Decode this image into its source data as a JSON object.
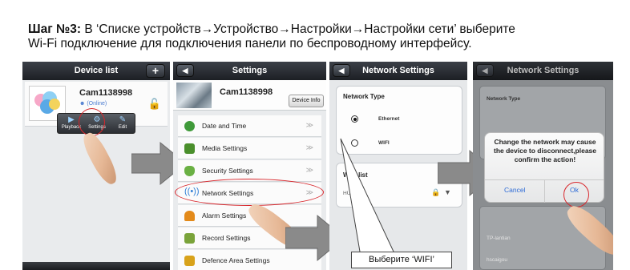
{
  "instruction": {
    "step": "Шаг №3:",
    "line1": "В ‘Списке устройств→Устройство→Настройки→Настройки сети’ выберите",
    "line2": "Wi-Fi подключение для подключения панели по беспроводному интерфейсу."
  },
  "device_list": {
    "title": "Device list",
    "add_label": "+",
    "device_name": "Cam1138998",
    "device_status": "(Online)",
    "actions": [
      {
        "label": "Playback",
        "icon": "play-icon"
      },
      {
        "label": "Settings",
        "icon": "gear-icon"
      },
      {
        "label": "Edit",
        "icon": "edit-icon"
      }
    ]
  },
  "settings": {
    "title": "Settings",
    "device_name": "Cam1138998",
    "device_info_label": "Device Info",
    "items": [
      {
        "label": "Date and Time",
        "icon": "clock-icon",
        "color": "#3f9a3a"
      },
      {
        "label": "Media Settings",
        "icon": "film-icon",
        "color": "#4a8f2c"
      },
      {
        "label": "Security Settings",
        "icon": "shield-icon",
        "color": "#6ab043"
      },
      {
        "label": "Network Settings",
        "icon": "wifi-icon",
        "color": "#2f7fd6"
      },
      {
        "label": "Alarm Settings",
        "icon": "bell-icon",
        "color": "#e38a1a"
      },
      {
        "label": "Record Settings",
        "icon": "record-icon",
        "color": "#7aa33a"
      },
      {
        "label": "Defence Area Settings",
        "icon": "lock-icon",
        "color": "#d8a21a"
      }
    ],
    "chevron": "≫"
  },
  "network": {
    "title": "Network Settings",
    "type_title": "Network Type",
    "options": [
      "Ethernet",
      "WIFI"
    ],
    "wifi_list_title": "WIFI list",
    "wifi_first": "HUAWE",
    "callout": "Выберите ‘WIFI’"
  },
  "confirm": {
    "title": "Network Settings",
    "bg_type_title": "Network Type",
    "message": "Change the network may cause the device to disconnect,please confirm the action!",
    "cancel_label": "Cancel",
    "ok_label": "Ok",
    "bg_networks": [
      "TP-lantian",
      "hscaigou"
    ]
  },
  "colors": {
    "highlight": "#d8262b",
    "arrow": "#8a8a8a",
    "accent": "#2d6bd6"
  }
}
